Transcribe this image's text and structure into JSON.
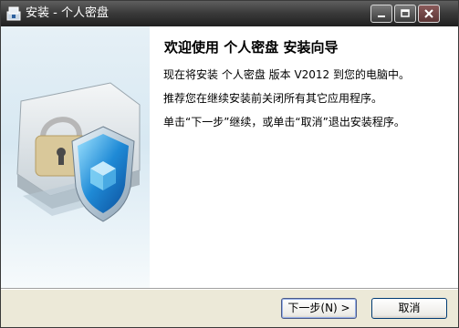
{
  "window": {
    "title": "安装 - 个人密盘",
    "minimize_icon": "minimize-icon",
    "maximize_icon": "maximize-icon",
    "close_icon": "close-icon"
  },
  "left_panel": {
    "image": "hard-drive-lock-shield-icon"
  },
  "main": {
    "heading": "欢迎使用  个人密盘  安装向导",
    "paragraph1": "现在将安装 个人密盘 版本 V2012 到您的电脑中。",
    "paragraph2": "推荐您在继续安装前关闭所有其它应用程序。",
    "paragraph3": "单击“下一步”继续，或单击“取消”退出安装程序。"
  },
  "buttons": {
    "next_label": "下一步(N) >",
    "cancel_label": "取消"
  },
  "colors": {
    "titlebar": "#3c3c3c",
    "panel_bg": "#d7e8f2",
    "button_border": "#003c74"
  }
}
